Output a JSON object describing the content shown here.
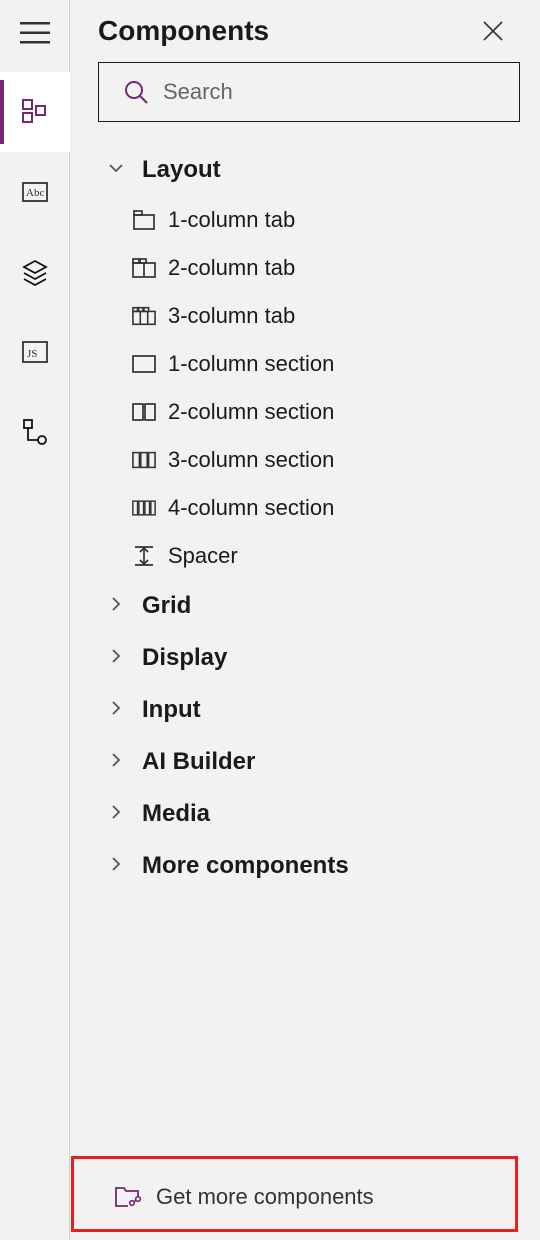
{
  "panel": {
    "title": "Components",
    "search_placeholder": "Search"
  },
  "groups": [
    {
      "name": "Layout",
      "expanded": true,
      "children": [
        {
          "label": "1-column tab",
          "icon": "tab1"
        },
        {
          "label": "2-column tab",
          "icon": "tab2"
        },
        {
          "label": "3-column tab",
          "icon": "tab3"
        },
        {
          "label": "1-column section",
          "icon": "sec1"
        },
        {
          "label": "2-column section",
          "icon": "sec2"
        },
        {
          "label": "3-column section",
          "icon": "sec3"
        },
        {
          "label": "4-column section",
          "icon": "sec4"
        },
        {
          "label": "Spacer",
          "icon": "spacer"
        }
      ]
    },
    {
      "name": "Grid",
      "expanded": false,
      "children": []
    },
    {
      "name": "Display",
      "expanded": false,
      "children": []
    },
    {
      "name": "Input",
      "expanded": false,
      "children": []
    },
    {
      "name": "AI Builder",
      "expanded": false,
      "children": []
    },
    {
      "name": "Media",
      "expanded": false,
      "children": []
    },
    {
      "name": "More components",
      "expanded": false,
      "children": []
    }
  ],
  "footer": {
    "label": "Get more components"
  }
}
